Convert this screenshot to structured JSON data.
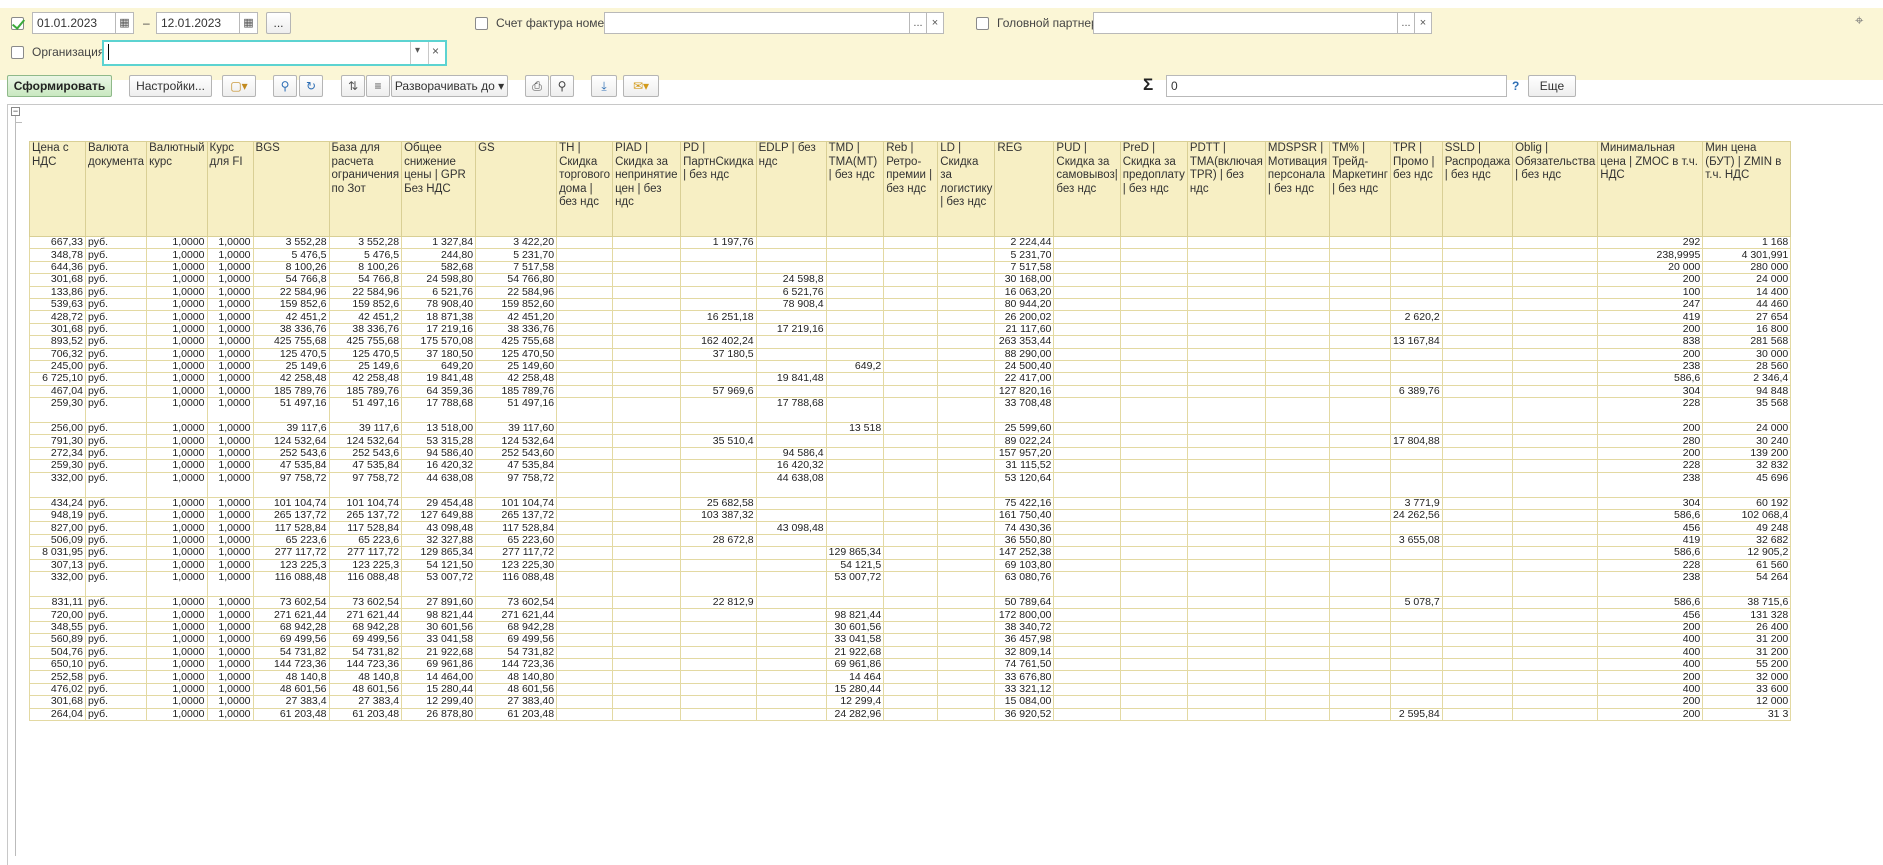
{
  "filters": {
    "date_from": "01.01.2023",
    "date_sep": "–",
    "date_to": "12.01.2023",
    "more_btn": "...",
    "invoice_label": "Счет фактура номер:",
    "partner_label": "Головной партнер:",
    "org_label": "Организация:",
    "dots": "...",
    "clear": "×",
    "dropdown": "▾"
  },
  "toolbar": {
    "generate": "Сформировать",
    "settings": "Настройки...",
    "expand_to": "Разворачивать до",
    "sum_symbol": "Σ",
    "sum_value": "0",
    "help": "?",
    "more": "Еще"
  },
  "grid": {
    "collapse": "−",
    "columns": [
      "Цена с НДС",
      "Валюта документа",
      "Валютный курс",
      "Курс для FI",
      "BGS",
      "База для расчета ограничения по Зот",
      "Общее снижение цены | GPR Без НДС",
      "GS",
      "TH | Скидка торгового дома | без ндс",
      "PIAD | Скидка за непринятие цен | без ндс",
      "PD | ПартнСкидка | без ндс",
      "EDLP | без ндс",
      "TMD | TMA(MT) | без ндс",
      "Reb | Ретро-премии | без ндс",
      "LD | Скидка за логистику | без ндс",
      "REG",
      "PUD | Скидка за самовывоз| без ндс",
      "PreD | Скидка за предоплату | без ндс",
      "PDTT | TMA(включая TPR) | без ндс",
      "MDSPSR | Мотивация персонала | без ндс",
      "TM% | Трейд-Маркетинг | без ндс",
      "TPR | Промо | без ндс",
      "SSLD | Распродажа | без ндс",
      "Oblig | Обязательства | без ндс",
      "Минимальная цена | ZMOC в т.ч. НДС",
      "Мин цена (БУТ) | ZMIN в т.ч. НДС"
    ],
    "rows": [
      [
        "667,33",
        "руб.",
        "1,0000",
        "1,0000",
        "3 552,28",
        "3 552,28",
        "1 327,84",
        "3 422,20",
        "",
        "",
        "1 197,76",
        "",
        "",
        "",
        "",
        "2 224,44",
        "",
        "",
        "",
        "",
        "",
        "",
        "",
        "",
        "292",
        "1 168"
      ],
      [
        "348,78",
        "руб.",
        "1,0000",
        "1,0000",
        "5 476,5",
        "5 476,5",
        "244,80",
        "5 231,70",
        "",
        "",
        "",
        "",
        "",
        "",
        "",
        "5 231,70",
        "",
        "",
        "",
        "",
        "",
        "",
        "",
        "",
        "238,9995",
        "4 301,991"
      ],
      [
        "644,36",
        "руб.",
        "1,0000",
        "1,0000",
        "8 100,26",
        "8 100,26",
        "582,68",
        "7 517,58",
        "",
        "",
        "",
        "",
        "",
        "",
        "",
        "7 517,58",
        "",
        "",
        "",
        "",
        "",
        "",
        "",
        "",
        "20 000",
        "280 000"
      ],
      [
        "301,68",
        "руб.",
        "1,0000",
        "1,0000",
        "54 766,8",
        "54 766,8",
        "24 598,80",
        "54 766,80",
        "",
        "",
        "",
        "24 598,8",
        "",
        "",
        "",
        "30 168,00",
        "",
        "",
        "",
        "",
        "",
        "",
        "",
        "",
        "200",
        "24 000"
      ],
      [
        "133,86",
        "руб.",
        "1,0000",
        "1,0000",
        "22 584,96",
        "22 584,96",
        "6 521,76",
        "22 584,96",
        "",
        "",
        "",
        "6 521,76",
        "",
        "",
        "",
        "16 063,20",
        "",
        "",
        "",
        "",
        "",
        "",
        "",
        "",
        "100",
        "14 400"
      ],
      [
        "539,63",
        "руб.",
        "1,0000",
        "1,0000",
        "159 852,6",
        "159 852,6",
        "78 908,40",
        "159 852,60",
        "",
        "",
        "",
        "78 908,4",
        "",
        "",
        "",
        "80 944,20",
        "",
        "",
        "",
        "",
        "",
        "",
        "",
        "",
        "247",
        "44 460"
      ],
      [
        "428,72",
        "руб.",
        "1,0000",
        "1,0000",
        "42 451,2",
        "42 451,2",
        "18 871,38",
        "42 451,20",
        "",
        "",
        "16 251,18",
        "",
        "",
        "",
        "",
        "26 200,02",
        "",
        "",
        "",
        "",
        "",
        "2 620,2",
        "",
        "",
        "419",
        "27 654"
      ],
      [
        "301,68",
        "руб.",
        "1,0000",
        "1,0000",
        "38 336,76",
        "38 336,76",
        "17 219,16",
        "38 336,76",
        "",
        "",
        "",
        "17 219,16",
        "",
        "",
        "",
        "21 117,60",
        "",
        "",
        "",
        "",
        "",
        "",
        "",
        "",
        "200",
        "16 800"
      ],
      [
        "893,52",
        "руб.",
        "1,0000",
        "1,0000",
        "425 755,68",
        "425 755,68",
        "175 570,08",
        "425 755,68",
        "",
        "",
        "162 402,24",
        "",
        "",
        "",
        "",
        "263 353,44",
        "",
        "",
        "",
        "",
        "",
        "13 167,84",
        "",
        "",
        "838",
        "281 568"
      ],
      [
        "706,32",
        "руб.",
        "1,0000",
        "1,0000",
        "125 470,5",
        "125 470,5",
        "37 180,50",
        "125 470,50",
        "",
        "",
        "37 180,5",
        "",
        "",
        "",
        "",
        "88 290,00",
        "",
        "",
        "",
        "",
        "",
        "",
        "",
        "",
        "200",
        "30 000"
      ],
      [
        "245,00",
        "руб.",
        "1,0000",
        "1,0000",
        "25 149,6",
        "25 149,6",
        "649,20",
        "25 149,60",
        "",
        "",
        "",
        "",
        "649,2",
        "",
        "",
        "24 500,40",
        "",
        "",
        "",
        "",
        "",
        "",
        "",
        "",
        "238",
        "28 560"
      ],
      [
        "6 725,10",
        "руб.",
        "1,0000",
        "1,0000",
        "42 258,48",
        "42 258,48",
        "19 841,48",
        "42 258,48",
        "",
        "",
        "",
        "19 841,48",
        "",
        "",
        "",
        "22 417,00",
        "",
        "",
        "",
        "",
        "",
        "",
        "",
        "",
        "586,6",
        "2 346,4"
      ],
      [
        "467,04",
        "руб.",
        "1,0000",
        "1,0000",
        "185 789,76",
        "185 789,76",
        "64 359,36",
        "185 789,76",
        "",
        "",
        "57 969,6",
        "",
        "",
        "",
        "",
        "127 820,16",
        "",
        "",
        "",
        "",
        "",
        "6 389,76",
        "",
        "",
        "304",
        "94 848"
      ],
      [
        "259,30",
        "руб.",
        "1,0000",
        "1,0000",
        "51 497,16",
        "51 497,16",
        "17 788,68",
        "51 497,16",
        "",
        "",
        "",
        "17 788,68",
        "",
        "",
        "",
        "33 708,48",
        "",
        "",
        "",
        "",
        "",
        "",
        "",
        "",
        "228",
        "35 568"
      ],
      [
        "256,00",
        "руб.",
        "1,0000",
        "1,0000",
        "39 117,6",
        "39 117,6",
        "13 518,00",
        "39 117,60",
        "",
        "",
        "",
        "",
        "13 518",
        "",
        "",
        "25 599,60",
        "",
        "",
        "",
        "",
        "",
        "",
        "",
        "",
        "200",
        "24 000"
      ],
      [
        "791,30",
        "руб.",
        "1,0000",
        "1,0000",
        "124 532,64",
        "124 532,64",
        "53 315,28",
        "124 532,64",
        "",
        "",
        "35 510,4",
        "",
        "",
        "",
        "",
        "89 022,24",
        "",
        "",
        "",
        "",
        "",
        "17 804,88",
        "",
        "",
        "280",
        "30 240"
      ],
      [
        "272,34",
        "руб.",
        "1,0000",
        "1,0000",
        "252 543,6",
        "252 543,6",
        "94 586,40",
        "252 543,60",
        "",
        "",
        "",
        "94 586,4",
        "",
        "",
        "",
        "157 957,20",
        "",
        "",
        "",
        "",
        "",
        "",
        "",
        "",
        "200",
        "139 200"
      ],
      [
        "259,30",
        "руб.",
        "1,0000",
        "1,0000",
        "47 535,84",
        "47 535,84",
        "16 420,32",
        "47 535,84",
        "",
        "",
        "",
        "16 420,32",
        "",
        "",
        "",
        "31 115,52",
        "",
        "",
        "",
        "",
        "",
        "",
        "",
        "",
        "228",
        "32 832"
      ],
      [
        "332,00",
        "руб.",
        "1,0000",
        "1,0000",
        "97 758,72",
        "97 758,72",
        "44 638,08",
        "97 758,72",
        "",
        "",
        "",
        "44 638,08",
        "",
        "",
        "",
        "53 120,64",
        "",
        "",
        "",
        "",
        "",
        "",
        "",
        "",
        "238",
        "45 696"
      ],
      [
        "434,24",
        "руб.",
        "1,0000",
        "1,0000",
        "101 104,74",
        "101 104,74",
        "29 454,48",
        "101 104,74",
        "",
        "",
        "25 682,58",
        "",
        "",
        "",
        "",
        "75 422,16",
        "",
        "",
        "",
        "",
        "",
        "3 771,9",
        "",
        "",
        "304",
        "60 192"
      ],
      [
        "948,19",
        "руб.",
        "1,0000",
        "1,0000",
        "265 137,72",
        "265 137,72",
        "127 649,88",
        "265 137,72",
        "",
        "",
        "103 387,32",
        "",
        "",
        "",
        "",
        "161 750,40",
        "",
        "",
        "",
        "",
        "",
        "24 262,56",
        "",
        "",
        "586,6",
        "102 068,4"
      ],
      [
        "827,00",
        "руб.",
        "1,0000",
        "1,0000",
        "117 528,84",
        "117 528,84",
        "43 098,48",
        "117 528,84",
        "",
        "",
        "",
        "43 098,48",
        "",
        "",
        "",
        "74 430,36",
        "",
        "",
        "",
        "",
        "",
        "",
        "",
        "",
        "456",
        "49 248"
      ],
      [
        "506,09",
        "руб.",
        "1,0000",
        "1,0000",
        "65 223,6",
        "65 223,6",
        "32 327,88",
        "65 223,60",
        "",
        "",
        "28 672,8",
        "",
        "",
        "",
        "",
        "36 550,80",
        "",
        "",
        "",
        "",
        "",
        "3 655,08",
        "",
        "",
        "419",
        "32 682"
      ],
      [
        "8 031,95",
        "руб.",
        "1,0000",
        "1,0000",
        "277 117,72",
        "277 117,72",
        "129 865,34",
        "277 117,72",
        "",
        "",
        "",
        "",
        "129 865,34",
        "",
        "",
        "147 252,38",
        "",
        "",
        "",
        "",
        "",
        "",
        "",
        "",
        "586,6",
        "12 905,2"
      ],
      [
        "307,13",
        "руб.",
        "1,0000",
        "1,0000",
        "123 225,3",
        "123 225,3",
        "54 121,50",
        "123 225,30",
        "",
        "",
        "",
        "",
        "54 121,5",
        "",
        "",
        "69 103,80",
        "",
        "",
        "",
        "",
        "",
        "",
        "",
        "",
        "228",
        "61 560"
      ],
      [
        "332,00",
        "руб.",
        "1,0000",
        "1,0000",
        "116 088,48",
        "116 088,48",
        "53 007,72",
        "116 088,48",
        "",
        "",
        "",
        "",
        "53 007,72",
        "",
        "",
        "63 080,76",
        "",
        "",
        "",
        "",
        "",
        "",
        "",
        "",
        "238",
        "54 264"
      ],
      [
        "831,11",
        "руб.",
        "1,0000",
        "1,0000",
        "73 602,54",
        "73 602,54",
        "27 891,60",
        "73 602,54",
        "",
        "",
        "22 812,9",
        "",
        "",
        "",
        "",
        "50 789,64",
        "",
        "",
        "",
        "",
        "",
        "5 078,7",
        "",
        "",
        "586,6",
        "38 715,6"
      ],
      [
        "720,00",
        "руб.",
        "1,0000",
        "1,0000",
        "271 621,44",
        "271 621,44",
        "98 821,44",
        "271 621,44",
        "",
        "",
        "",
        "",
        "98 821,44",
        "",
        "",
        "172 800,00",
        "",
        "",
        "",
        "",
        "",
        "",
        "",
        "",
        "456",
        "131 328"
      ],
      [
        "348,55",
        "руб.",
        "1,0000",
        "1,0000",
        "68 942,28",
        "68 942,28",
        "30 601,56",
        "68 942,28",
        "",
        "",
        "",
        "",
        "30 601,56",
        "",
        "",
        "38 340,72",
        "",
        "",
        "",
        "",
        "",
        "",
        "",
        "",
        "200",
        "26 400"
      ],
      [
        "560,89",
        "руб.",
        "1,0000",
        "1,0000",
        "69 499,56",
        "69 499,56",
        "33 041,58",
        "69 499,56",
        "",
        "",
        "",
        "",
        "33 041,58",
        "",
        "",
        "36 457,98",
        "",
        "",
        "",
        "",
        "",
        "",
        "",
        "",
        "400",
        "31 200"
      ],
      [
        "504,76",
        "руб.",
        "1,0000",
        "1,0000",
        "54 731,82",
        "54 731,82",
        "21 922,68",
        "54 731,82",
        "",
        "",
        "",
        "",
        "21 922,68",
        "",
        "",
        "32 809,14",
        "",
        "",
        "",
        "",
        "",
        "",
        "",
        "",
        "400",
        "31 200"
      ],
      [
        "650,10",
        "руб.",
        "1,0000",
        "1,0000",
        "144 723,36",
        "144 723,36",
        "69 961,86",
        "144 723,36",
        "",
        "",
        "",
        "",
        "69 961,86",
        "",
        "",
        "74 761,50",
        "",
        "",
        "",
        "",
        "",
        "",
        "",
        "",
        "400",
        "55 200"
      ],
      [
        "252,58",
        "руб.",
        "1,0000",
        "1,0000",
        "48 140,8",
        "48 140,8",
        "14 464,00",
        "48 140,80",
        "",
        "",
        "",
        "",
        "14 464",
        "",
        "",
        "33 676,80",
        "",
        "",
        "",
        "",
        "",
        "",
        "",
        "",
        "200",
        "32 000"
      ],
      [
        "476,02",
        "руб.",
        "1,0000",
        "1,0000",
        "48 601,56",
        "48 601,56",
        "15 280,44",
        "48 601,56",
        "",
        "",
        "",
        "",
        "15 280,44",
        "",
        "",
        "33 321,12",
        "",
        "",
        "",
        "",
        "",
        "",
        "",
        "",
        "400",
        "33 600"
      ],
      [
        "301,68",
        "руб.",
        "1,0000",
        "1,0000",
        "27 383,4",
        "27 383,4",
        "12 299,40",
        "27 383,40",
        "",
        "",
        "",
        "",
        "12 299,4",
        "",
        "",
        "15 084,00",
        "",
        "",
        "",
        "",
        "",
        "",
        "",
        "",
        "200",
        "12 000"
      ],
      [
        "264,04",
        "руб.",
        "1,0000",
        "1,0000",
        "61 203,48",
        "61 203,48",
        "26 878,80",
        "61 203,48",
        "",
        "",
        "",
        "",
        "24 282,96",
        "",
        "",
        "36 920,52",
        "",
        "",
        "",
        "",
        "",
        "2 595,84",
        "",
        "",
        "200",
        "31 3"
      ]
    ]
  }
}
